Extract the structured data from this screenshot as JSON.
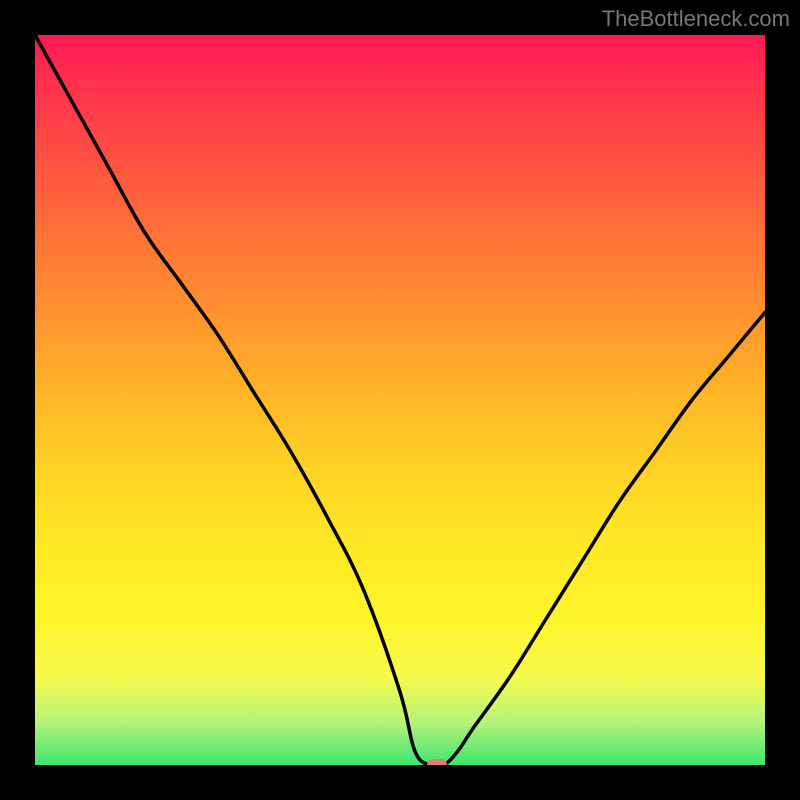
{
  "watermark": "TheBottleneck.com",
  "colors": {
    "frame": "#000000",
    "curve": "#000000",
    "marker": "#e07b7e"
  },
  "chart_data": {
    "type": "line",
    "title": "",
    "xlabel": "",
    "ylabel": "",
    "xlim": [
      0,
      100
    ],
    "ylim": [
      0,
      100
    ],
    "grid": false,
    "legend": false,
    "description": "V-shaped bottleneck curve on rainbow gradient. Y=0 (bottom/green) is optimal match; higher Y (top/red) is severe bottleneck. Minimum around x≈54.",
    "series": [
      {
        "name": "bottleneck-curve",
        "x": [
          0,
          5,
          10,
          15,
          20,
          25,
          30,
          35,
          40,
          45,
          50,
          52,
          54,
          56,
          58,
          60,
          65,
          70,
          75,
          80,
          85,
          90,
          95,
          100
        ],
        "y": [
          100,
          91,
          82,
          73,
          66,
          59,
          51,
          43,
          34,
          24,
          10,
          2,
          0,
          0,
          2,
          5,
          12,
          20,
          28,
          36,
          43,
          50,
          56,
          62
        ]
      }
    ],
    "marker": {
      "x": 55,
      "y": 0
    }
  }
}
